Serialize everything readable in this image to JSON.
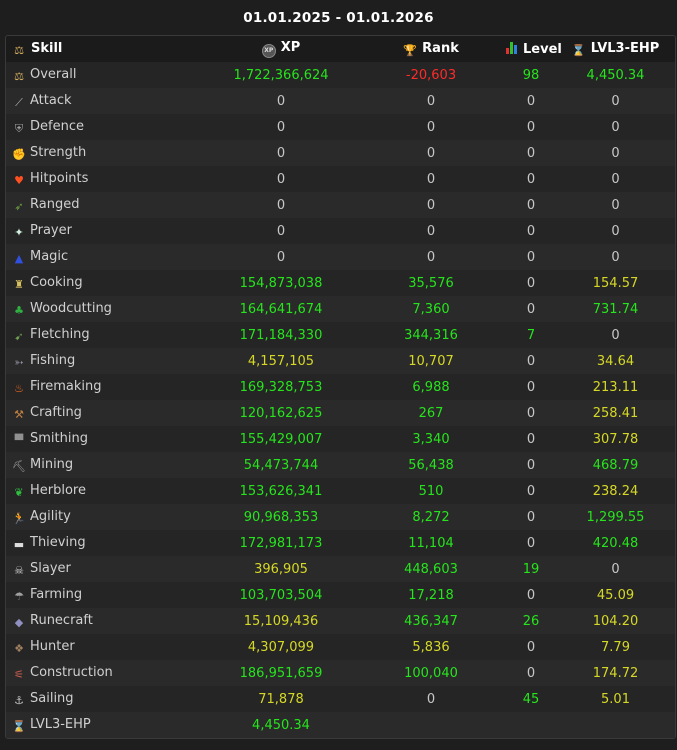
{
  "date_range": "01.01.2025 - 01.01.2026",
  "columns": {
    "skill": "Skill",
    "xp": "XP",
    "rank": "Rank",
    "level": "Level",
    "ehp": "LVL3-EHP"
  },
  "colors": {
    "green": "#26e51c",
    "yellow": "#d6d826",
    "red": "#ff2a2a",
    "gray": "#c8c8c8"
  },
  "rows": [
    {
      "skill": "Overall",
      "icon": "overall-icon",
      "xp": "1,722,366,624",
      "xp_c": "g",
      "rank": "-20,603",
      "rank_c": "r",
      "level": "98",
      "level_c": "g",
      "ehp": "4,450.34",
      "ehp_c": "g"
    },
    {
      "skill": "Attack",
      "icon": "sword-icon",
      "xp": "0",
      "xp_c": "w",
      "rank": "0",
      "rank_c": "w",
      "level": "0",
      "level_c": "w",
      "ehp": "0",
      "ehp_c": "w"
    },
    {
      "skill": "Defence",
      "icon": "shield-icon",
      "xp": "0",
      "xp_c": "w",
      "rank": "0",
      "rank_c": "w",
      "level": "0",
      "level_c": "w",
      "ehp": "0",
      "ehp_c": "w"
    },
    {
      "skill": "Strength",
      "icon": "fist-icon",
      "xp": "0",
      "xp_c": "w",
      "rank": "0",
      "rank_c": "w",
      "level": "0",
      "level_c": "w",
      "ehp": "0",
      "ehp_c": "w"
    },
    {
      "skill": "Hitpoints",
      "icon": "heart-icon",
      "xp": "0",
      "xp_c": "w",
      "rank": "0",
      "rank_c": "w",
      "level": "0",
      "level_c": "w",
      "ehp": "0",
      "ehp_c": "w"
    },
    {
      "skill": "Ranged",
      "icon": "bow-icon",
      "xp": "0",
      "xp_c": "w",
      "rank": "0",
      "rank_c": "w",
      "level": "0",
      "level_c": "w",
      "ehp": "0",
      "ehp_c": "w"
    },
    {
      "skill": "Prayer",
      "icon": "prayer-star-icon",
      "xp": "0",
      "xp_c": "w",
      "rank": "0",
      "rank_c": "w",
      "level": "0",
      "level_c": "w",
      "ehp": "0",
      "ehp_c": "w"
    },
    {
      "skill": "Magic",
      "icon": "wizard-hat-icon",
      "xp": "0",
      "xp_c": "w",
      "rank": "0",
      "rank_c": "w",
      "level": "0",
      "level_c": "w",
      "ehp": "0",
      "ehp_c": "w"
    },
    {
      "skill": "Cooking",
      "icon": "chef-hat-icon",
      "xp": "154,873,038",
      "xp_c": "g",
      "rank": "35,576",
      "rank_c": "g",
      "level": "0",
      "level_c": "w",
      "ehp": "154.57",
      "ehp_c": "y"
    },
    {
      "skill": "Woodcutting",
      "icon": "tree-icon",
      "xp": "164,641,674",
      "xp_c": "g",
      "rank": "7,360",
      "rank_c": "g",
      "level": "0",
      "level_c": "w",
      "ehp": "731.74",
      "ehp_c": "g"
    },
    {
      "skill": "Fletching",
      "icon": "arrow-icon",
      "xp": "171,184,330",
      "xp_c": "g",
      "rank": "344,316",
      "rank_c": "g",
      "level": "7",
      "level_c": "g",
      "ehp": "0",
      "ehp_c": "w"
    },
    {
      "skill": "Fishing",
      "icon": "fish-icon",
      "xp": "4,157,105",
      "xp_c": "y",
      "rank": "10,707",
      "rank_c": "y",
      "level": "0",
      "level_c": "w",
      "ehp": "34.64",
      "ehp_c": "y"
    },
    {
      "skill": "Firemaking",
      "icon": "fire-icon",
      "xp": "169,328,753",
      "xp_c": "g",
      "rank": "6,988",
      "rank_c": "g",
      "level": "0",
      "level_c": "w",
      "ehp": "213.11",
      "ehp_c": "y"
    },
    {
      "skill": "Crafting",
      "icon": "chisel-icon",
      "xp": "120,162,625",
      "xp_c": "g",
      "rank": "267",
      "rank_c": "g",
      "level": "0",
      "level_c": "w",
      "ehp": "258.41",
      "ehp_c": "y"
    },
    {
      "skill": "Smithing",
      "icon": "anvil-icon",
      "xp": "155,429,007",
      "xp_c": "g",
      "rank": "3,340",
      "rank_c": "g",
      "level": "0",
      "level_c": "w",
      "ehp": "307.78",
      "ehp_c": "y"
    },
    {
      "skill": "Mining",
      "icon": "pickaxe-icon",
      "xp": "54,473,744",
      "xp_c": "g",
      "rank": "56,438",
      "rank_c": "g",
      "level": "0",
      "level_c": "w",
      "ehp": "468.79",
      "ehp_c": "g"
    },
    {
      "skill": "Herblore",
      "icon": "herb-icon",
      "xp": "153,626,341",
      "xp_c": "g",
      "rank": "510",
      "rank_c": "g",
      "level": "0",
      "level_c": "w",
      "ehp": "238.24",
      "ehp_c": "y"
    },
    {
      "skill": "Agility",
      "icon": "runner-icon",
      "xp": "90,968,353",
      "xp_c": "g",
      "rank": "8,272",
      "rank_c": "g",
      "level": "0",
      "level_c": "w",
      "ehp": "1,299.55",
      "ehp_c": "g"
    },
    {
      "skill": "Thieving",
      "icon": "mask-icon",
      "xp": "172,981,173",
      "xp_c": "g",
      "rank": "11,104",
      "rank_c": "g",
      "level": "0",
      "level_c": "w",
      "ehp": "420.48",
      "ehp_c": "g"
    },
    {
      "skill": "Slayer",
      "icon": "skull-icon",
      "xp": "396,905",
      "xp_c": "y",
      "rank": "448,603",
      "rank_c": "g",
      "level": "19",
      "level_c": "g",
      "ehp": "0",
      "ehp_c": "w"
    },
    {
      "skill": "Farming",
      "icon": "watering-can-icon",
      "xp": "103,703,504",
      "xp_c": "g",
      "rank": "17,218",
      "rank_c": "g",
      "level": "0",
      "level_c": "w",
      "ehp": "45.09",
      "ehp_c": "y"
    },
    {
      "skill": "Runecraft",
      "icon": "rune-icon",
      "xp": "15,109,436",
      "xp_c": "y",
      "rank": "436,347",
      "rank_c": "g",
      "level": "26",
      "level_c": "g",
      "ehp": "104.20",
      "ehp_c": "y"
    },
    {
      "skill": "Hunter",
      "icon": "paw-icon",
      "xp": "4,307,099",
      "xp_c": "y",
      "rank": "5,836",
      "rank_c": "y",
      "level": "0",
      "level_c": "w",
      "ehp": "7.79",
      "ehp_c": "y"
    },
    {
      "skill": "Construction",
      "icon": "saw-icon",
      "xp": "186,951,659",
      "xp_c": "g",
      "rank": "100,040",
      "rank_c": "g",
      "level": "0",
      "level_c": "w",
      "ehp": "174.72",
      "ehp_c": "y"
    },
    {
      "skill": "Sailing",
      "icon": "sailing-icon",
      "xp": "71,878",
      "xp_c": "y",
      "rank": "0",
      "rank_c": "w",
      "level": "45",
      "level_c": "g",
      "ehp": "5.01",
      "ehp_c": "y"
    }
  ],
  "footer": {
    "label": "LVL3-EHP",
    "value": "4,450.34"
  }
}
